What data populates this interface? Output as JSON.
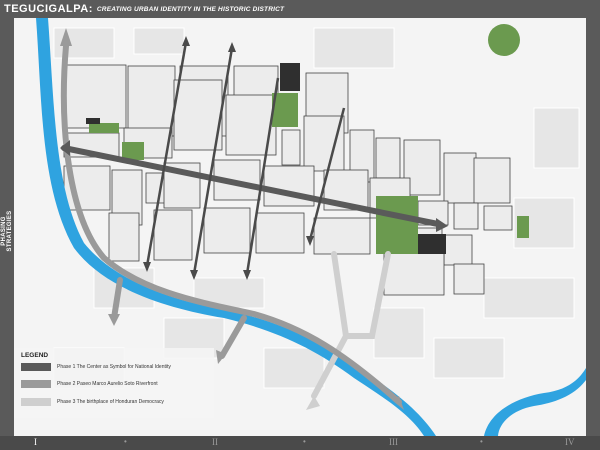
{
  "header": {
    "title": "TEGUCIGALPA:",
    "subtitle": "CREATING URBAN IDENTITY IN THE HISTORIC DISTRICT"
  },
  "side_label": "PHASING STRATEGIES",
  "legend": {
    "title": "LEGEND",
    "items": [
      {
        "label": "Phase 1  The Center as Symbol for National Identity",
        "color": "#5a5a5a"
      },
      {
        "label": "Phase 2  Paseo Marco Aurelio Soto Riverfront",
        "color": "#9a9a9a"
      },
      {
        "label": "Phase 3  The birthplace of Honduran Democracy",
        "color": "#cfcfcf"
      }
    ]
  },
  "footer": {
    "pages": [
      "I",
      "II",
      "III",
      "IV"
    ],
    "active_page": "I"
  },
  "colors": {
    "river": "#2fa3e0",
    "park_green": "#6b9a4f",
    "dark_building": "#2f2f2f",
    "phase1": "#5a5a5a",
    "phase2": "#9a9a9a",
    "phase3": "#cfcfcf",
    "frame": "#5a5a5a"
  }
}
